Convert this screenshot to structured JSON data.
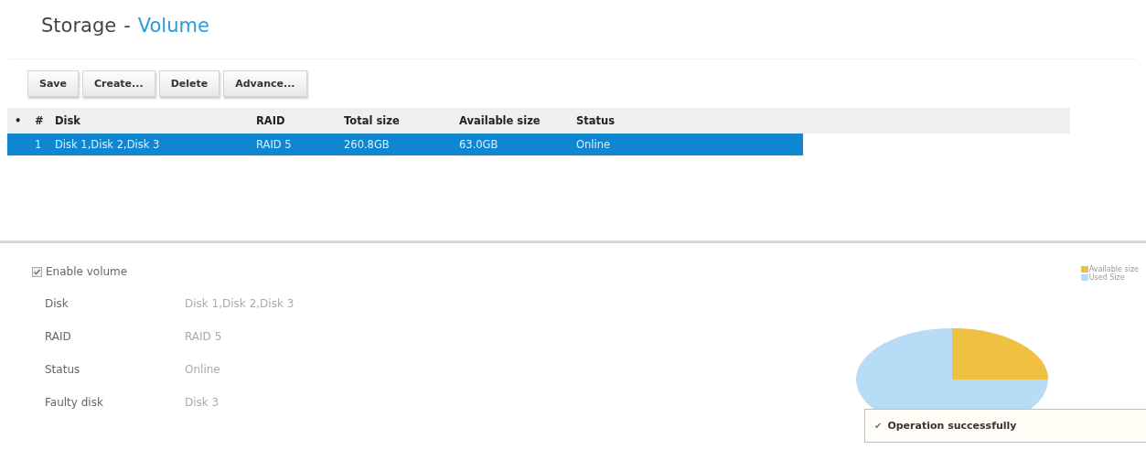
{
  "page_title": {
    "section": "Storage",
    "separator": "-",
    "page": "Volume"
  },
  "toolbar": [
    "Save",
    "Create...",
    "Delete",
    "Advance..."
  ],
  "table": {
    "marker_column": "•",
    "columns": [
      "#",
      "Disk",
      "RAID",
      "Total size",
      "Available size",
      "Status"
    ],
    "rows": [
      {
        "cells": [
          "1",
          "Disk 1,Disk 2,Disk 3",
          "RAID 5",
          "260.8GB",
          "63.0GB",
          "Online"
        ],
        "selected": true
      }
    ]
  },
  "details": {
    "enable_volume": {
      "label": "Enable volume",
      "checked": true
    },
    "fields": [
      {
        "label": "Disk",
        "value": "Disk 1,Disk 2,Disk 3"
      },
      {
        "label": "RAID",
        "value": "RAID 5"
      },
      {
        "label": "Status",
        "value": "Online"
      },
      {
        "label": "Faulty disk",
        "value": "Disk 3"
      }
    ]
  },
  "legend": [
    {
      "label": "Available size",
      "color": "#f0c040"
    },
    {
      "label": "Used Size",
      "color": "#b8dcf6"
    }
  ],
  "toast": {
    "icon": "✔",
    "message": "Operation successfully"
  }
}
